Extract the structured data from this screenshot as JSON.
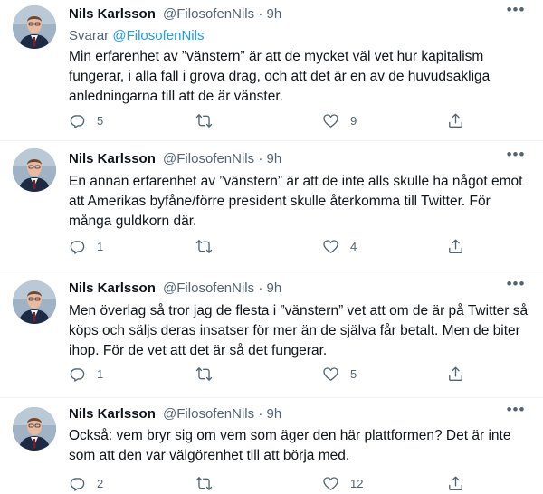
{
  "tweets": [
    {
      "name": "Nils Karlsson",
      "handle": "@FilosofenNils",
      "separator": "·",
      "time": "9h",
      "replying_prefix": "Svarar",
      "replying_to": "@FilosofenNils",
      "text": "Min erfarenhet av ”vänstern” är att de mycket väl vet hur kapitalism fungerar, i alla fall i grova drag, och att det är en av de huvudsakliga anledningarna till att de är vänster.",
      "replies": "5",
      "retweets": "",
      "likes": "9"
    },
    {
      "name": "Nils Karlsson",
      "handle": "@FilosofenNils",
      "separator": "·",
      "time": "9h",
      "text": "En annan erfarenhet av ”vänstern” är att de inte alls skulle ha något emot att Amerikas byfåne/förre president skulle återkomma till Twitter. För många guldkorn där.",
      "replies": "1",
      "retweets": "",
      "likes": "4"
    },
    {
      "name": "Nils Karlsson",
      "handle": "@FilosofenNils",
      "separator": "·",
      "time": "9h",
      "text": "Men överlag så tror jag de flesta i ”vänstern” vet att om de är på Twitter så köps och säljs deras insatser för mer än de själva får betalt. Men de biter ihop. För de vet att det är så det fungerar.",
      "replies": "1",
      "retweets": "",
      "likes": "5"
    },
    {
      "name": "Nils Karlsson",
      "handle": "@FilosofenNils",
      "separator": "·",
      "time": "9h",
      "text": "Också: vem bryr sig om vem som äger den här plattformen? Det är inte som att den var välgörenhet till att börja med.",
      "replies": "2",
      "retweets": "",
      "likes": "12"
    }
  ],
  "icons": {
    "reply": "reply-icon",
    "retweet": "retweet-icon",
    "like": "heart-icon",
    "share": "share-icon",
    "more": "more-icon"
  },
  "colors": {
    "text": "#0f1419",
    "secondary": "#536471",
    "link": "#1d9bf0"
  }
}
